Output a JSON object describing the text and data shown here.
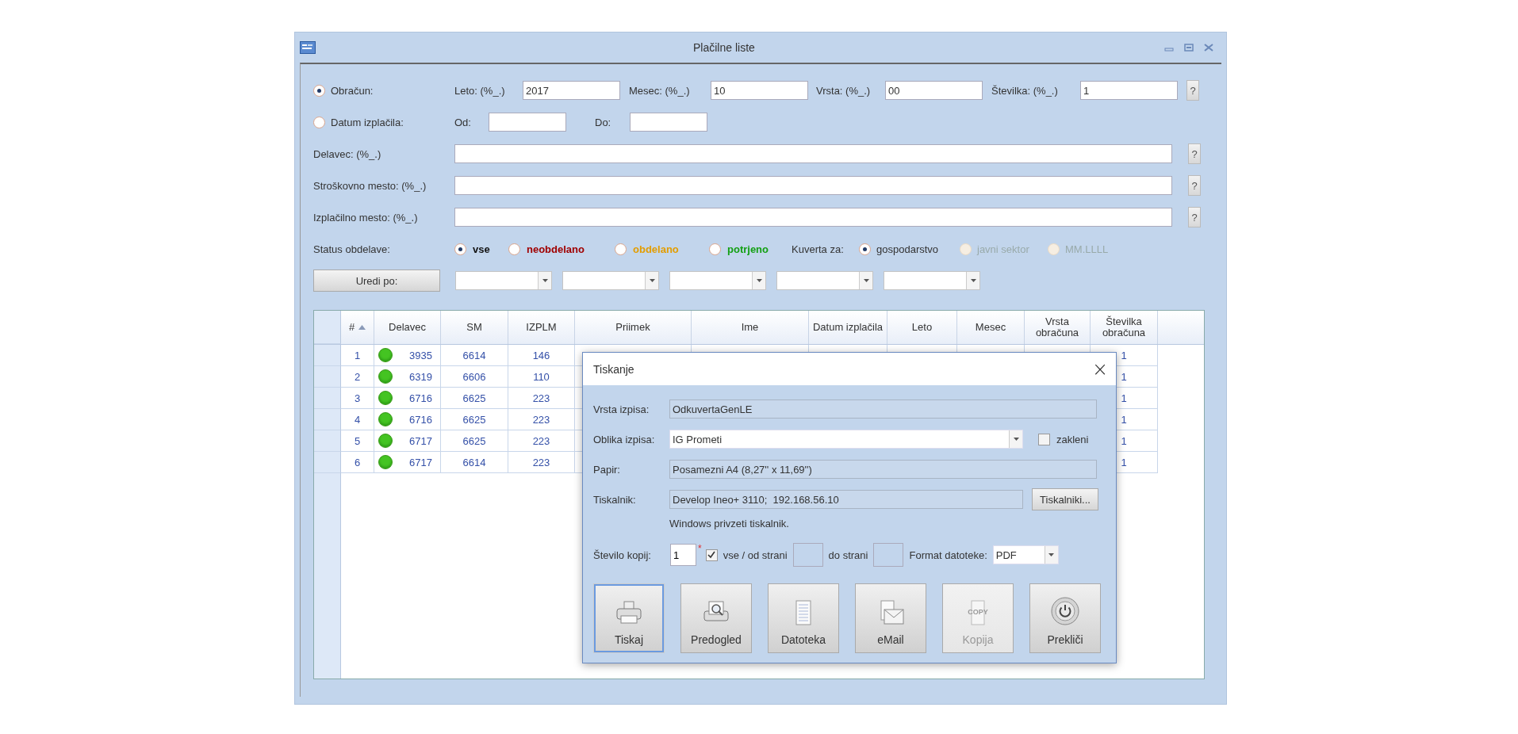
{
  "window": {
    "title": "Plačilne liste"
  },
  "mode": [
    {
      "label": "Obračun:",
      "selected": true
    },
    {
      "label": "Datum izplačila:",
      "selected": false
    }
  ],
  "period": [
    {
      "label": "Leto: (%_.)",
      "value": "2017"
    },
    {
      "label": "Mesec: (%_.)",
      "value": "10"
    },
    {
      "label": "Vrsta: (%_.)",
      "value": "00"
    },
    {
      "label": "Številka: (%_.)",
      "value": "1"
    }
  ],
  "period_button": "?",
  "date_range": [
    {
      "label": "Od:"
    },
    {
      "label": "Do:"
    }
  ],
  "filters": [
    {
      "label": "Delavec: (%_.)",
      "button": "?"
    },
    {
      "label": "Stroškovno mesto: (%_.)",
      "button": "?"
    },
    {
      "label": "Izplačilno mesto: (%_.)",
      "button": "?"
    }
  ],
  "status": {
    "label": "Status obdelave:",
    "options": [
      {
        "label": "vse",
        "selected": true,
        "color": "#111111"
      },
      {
        "label": "neobdelano",
        "selected": false,
        "color": "#a00000"
      },
      {
        "label": "obdelano",
        "selected": false,
        "color": "#e39d00"
      },
      {
        "label": "potrjeno",
        "selected": false,
        "color": "#14a014"
      }
    ]
  },
  "envelope": {
    "label": "Kuverta za:",
    "options": [
      {
        "label": "gospodarstvo",
        "selected": true,
        "disabled": false
      },
      {
        "label": "javni sektor",
        "selected": false,
        "disabled": true
      },
      {
        "label": "MM.LLLL",
        "selected": false,
        "disabled": true
      }
    ]
  },
  "sort_button": "Uredi po:",
  "table": {
    "columns": [
      {
        "label": "#",
        "sorted": true
      },
      {
        "label": "Delavec",
        "sorted": false
      },
      {
        "label": "SM",
        "sorted": false
      },
      {
        "label": "IZPLM",
        "sorted": false
      },
      {
        "label": "Priimek",
        "sorted": false
      },
      {
        "label": "Ime",
        "sorted": false
      },
      {
        "label": "Datum izplačila",
        "sorted": false
      },
      {
        "label": "Leto",
        "sorted": false
      },
      {
        "label": "Mesec",
        "sorted": false
      },
      {
        "label": "Vrsta obračuna",
        "sorted": false
      },
      {
        "label": "Številka obračuna",
        "sorted": false
      }
    ],
    "rows": [
      {
        "num": "1",
        "color": "#44c422",
        "delavec": "3935",
        "sm": "6614",
        "izplm": "146",
        "stevilka": "1"
      },
      {
        "num": "2",
        "color": "#44c422",
        "delavec": "6319",
        "sm": "6606",
        "izplm": "110",
        "stevilka": "1"
      },
      {
        "num": "3",
        "color": "#44c422",
        "delavec": "6716",
        "sm": "6625",
        "izplm": "223",
        "stevilka": "1"
      },
      {
        "num": "4",
        "color": "#44c422",
        "delavec": "6716",
        "sm": "6625",
        "izplm": "223",
        "stevilka": "1"
      },
      {
        "num": "5",
        "color": "#44c422",
        "delavec": "6717",
        "sm": "6625",
        "izplm": "223",
        "stevilka": "1"
      },
      {
        "num": "6",
        "color": "#44c422",
        "delavec": "6717",
        "sm": "6614",
        "izplm": "223",
        "stevilka": "1"
      }
    ]
  },
  "dialog": {
    "title": "Tiskanje",
    "close": "×",
    "report_type": {
      "label": "Vrsta izpisa:",
      "value": "OdkuvertaGenLE"
    },
    "layout": {
      "label": "Oblika izpisa:",
      "value": "IG Prometi"
    },
    "lock": {
      "label": "zakleni",
      "checked": false
    },
    "paper": {
      "label": "Papir:",
      "value": "Posamezni A4 (8,27'' x 11,69'')"
    },
    "printer": {
      "label": "Tiskalnik:",
      "value": "Develop Ineo+ 3110;  192.168.56.10",
      "button": "Tiskalniki...",
      "note": "Windows privzeti tiskalnik."
    },
    "copies": {
      "label": "Število kopij:",
      "value": "1",
      "required": "*"
    },
    "all_pages": {
      "label": "vse / od strani",
      "checked": true
    },
    "to_page": {
      "label": "do strani"
    },
    "format": {
      "label": "Format datoteke:",
      "value": "PDF"
    },
    "actions": [
      {
        "label": "Tiskaj",
        "kind": "print",
        "selected": true,
        "disabled": false
      },
      {
        "label": "Predogled",
        "kind": "preview",
        "selected": false,
        "disabled": false
      },
      {
        "label": "Datoteka",
        "kind": "file",
        "selected": false,
        "disabled": false
      },
      {
        "label": "eMail",
        "kind": "mail",
        "selected": false,
        "disabled": false
      },
      {
        "label": "Kopija",
        "kind": "copy",
        "selected": false,
        "disabled": true,
        "icon_text": "COPY"
      },
      {
        "label": "Prekliči",
        "kind": "cancel",
        "selected": false,
        "disabled": false
      }
    ]
  }
}
